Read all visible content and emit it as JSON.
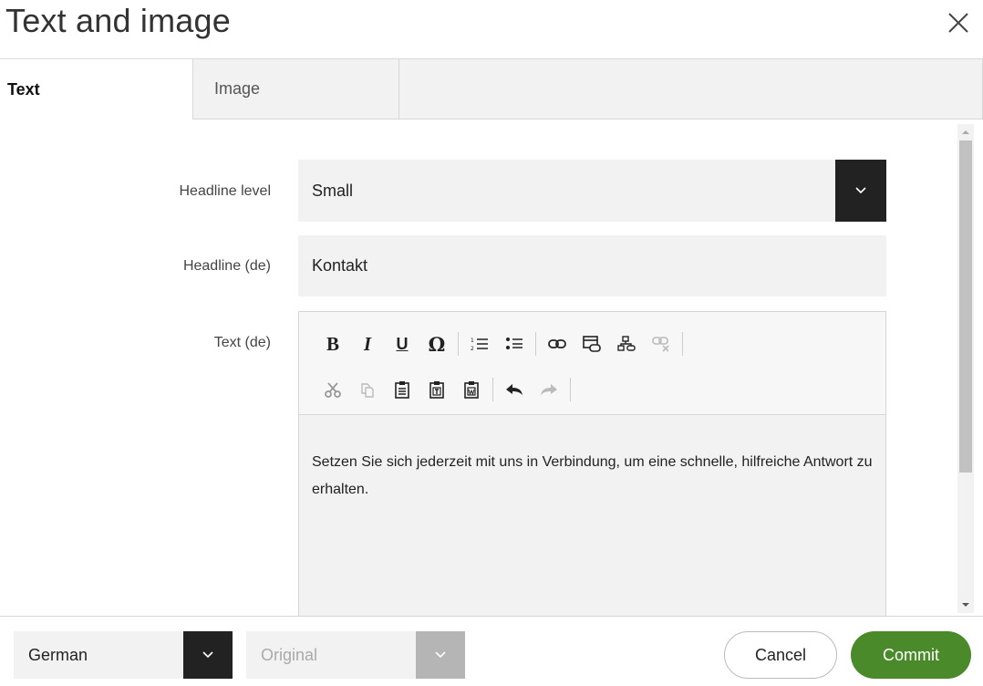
{
  "dialog": {
    "title": "Text and image"
  },
  "tabs": [
    {
      "label": "Text",
      "active": true
    },
    {
      "label": "Image",
      "active": false
    }
  ],
  "form": {
    "headline_level": {
      "label": "Headline level",
      "value": "Small"
    },
    "headline": {
      "label": "Headline (de)",
      "value": "Kontakt"
    },
    "text": {
      "label": "Text (de)",
      "body": "Setzen Sie sich jederzeit mit uns in Verbindung, um eine schnelle, hilfreiche Antwort zu erhalten."
    }
  },
  "toolbar": {
    "bold": "B",
    "italic": "I",
    "underline": "U",
    "special_char": "Ω"
  },
  "footer": {
    "language": "German",
    "version": "Original",
    "cancel_label": "Cancel",
    "commit_label": "Commit"
  },
  "colors": {
    "accent": "#4a8a2a",
    "field_bg": "#f2f2f2",
    "caret_bg": "#222222",
    "caret_disabled_bg": "#b5b5b5"
  }
}
